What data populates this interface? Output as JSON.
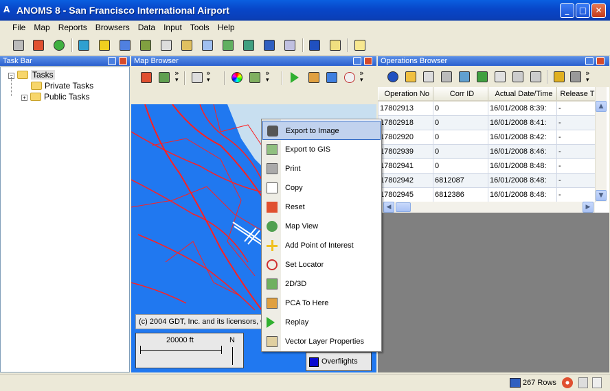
{
  "window": {
    "title": "ANOMS 8 - San Francisco International Airport",
    "app_icon": "A",
    "minimize": "_",
    "maximize": "□",
    "close": "✕"
  },
  "menu": [
    "File",
    "Map",
    "Reports",
    "Browsers",
    "Data",
    "Input",
    "Tools",
    "Help"
  ],
  "task_bar": {
    "title": "Task Bar",
    "root": "Tasks",
    "children": [
      "Private Tasks",
      "Public Tasks"
    ],
    "expander_minus": "−",
    "expander_plus": "+"
  },
  "map_browser": {
    "title": "Map Browser",
    "copyright": "(c) 2004 GDT, Inc. and its licensors, ©",
    "scale_label": "20000 ft",
    "north_label": "N",
    "legend_item": "Overflights",
    "legend_color": "#0a0ad0",
    "water_color": "#2078f0",
    "road_color": "#ff1010"
  },
  "context_menu": {
    "items": [
      {
        "label": "Export to Image",
        "icon": "camera-icon",
        "highlighted": true
      },
      {
        "label": "Export to GIS",
        "icon": "gis-icon"
      },
      {
        "label": "Print",
        "icon": "printer-icon"
      },
      {
        "label": "Copy",
        "icon": "copy-icon"
      },
      {
        "label": "Reset",
        "icon": "home-icon"
      },
      {
        "label": "Map View",
        "icon": "map-view-icon"
      },
      {
        "label": "Add Point of Interest",
        "icon": "crosshair-plus-icon"
      },
      {
        "label": "Set Locator",
        "icon": "locator-icon"
      },
      {
        "label": "2D/3D",
        "icon": "2d3d-icon"
      },
      {
        "label": "PCA To Here",
        "icon": "pca-icon"
      },
      {
        "label": "Replay",
        "icon": "play-icon"
      },
      {
        "label": "Vector Layer Properties",
        "icon": "vector-layer-icon"
      }
    ]
  },
  "operations_browser": {
    "title": "Operations Browser",
    "columns": [
      "Operation No",
      "Corr ID",
      "Actual Date/Time",
      "Release T"
    ],
    "rows": [
      [
        "17802913",
        "0",
        "16/01/2008 8:39:",
        "-"
      ],
      [
        "17802918",
        "0",
        "16/01/2008 8:41:",
        "-"
      ],
      [
        "17802920",
        "0",
        "16/01/2008 8:42:",
        "-"
      ],
      [
        "17802939",
        "0",
        "16/01/2008 8:46:",
        "-"
      ],
      [
        "17802941",
        "0",
        "16/01/2008 8:48:",
        "-"
      ],
      [
        "17802942",
        "6812087",
        "16/01/2008 8:48:",
        "-"
      ],
      [
        "17802945",
        "6812386",
        "16/01/2008 8:48:",
        "-"
      ]
    ]
  },
  "status": {
    "rows_label": "267 Rows"
  },
  "toolbar_overflow": "»",
  "toolbar_dropdown": "▾"
}
